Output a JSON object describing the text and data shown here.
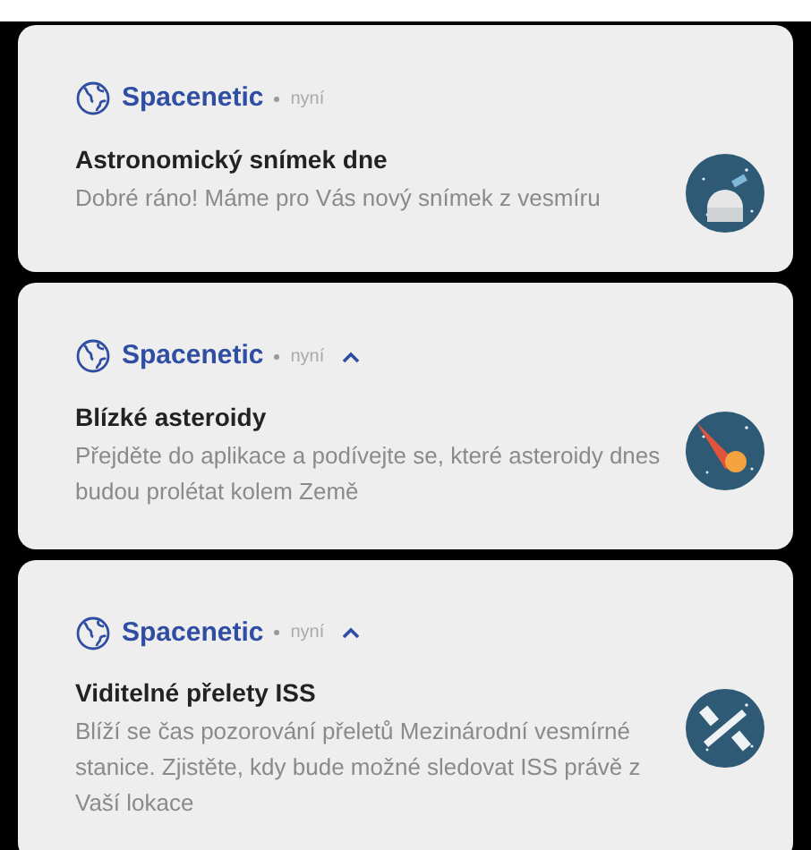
{
  "notifications": [
    {
      "app": "Spacenetic",
      "time": "nyní",
      "expanded": false,
      "title": "Astronomický snímek dne",
      "body": "Dobré ráno! Máme pro Vás nový snímek z vesmíru",
      "kind": "observatory"
    },
    {
      "app": "Spacenetic",
      "time": "nyní",
      "expanded": true,
      "title": "Blízké asteroidy",
      "body": "Přejděte do aplikace a podívejte se, které asteroidy dnes budou prolétat kolem Země",
      "kind": "asteroid"
    },
    {
      "app": "Spacenetic",
      "time": "nyní",
      "expanded": true,
      "title": "Viditelné přelety ISS",
      "body": "Blíží se čas pozorování přeletů Mezinárodní vesmírné stanice. Zjistěte, kdy bude možné sledovat ISS právě z Vaší lokace",
      "kind": "station"
    }
  ]
}
